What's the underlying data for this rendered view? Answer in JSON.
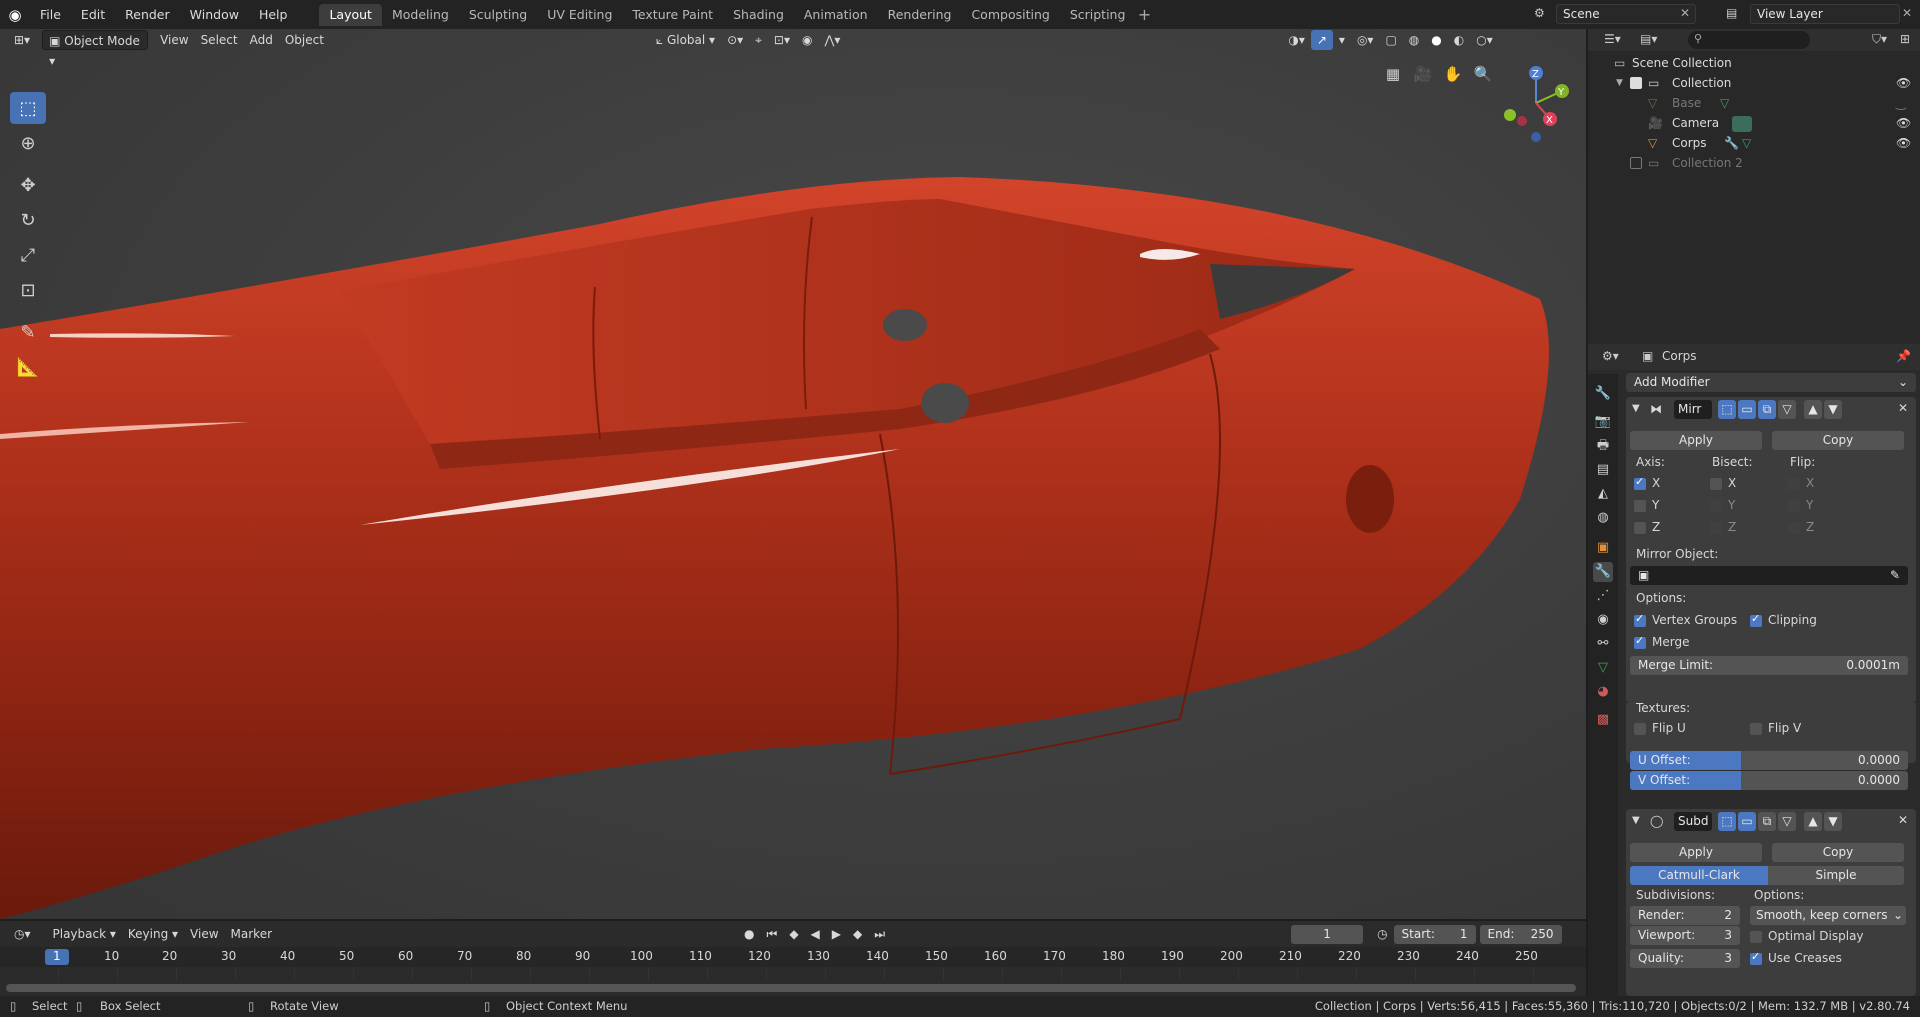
{
  "topbar": {
    "menus": [
      "File",
      "Edit",
      "Render",
      "Window",
      "Help"
    ],
    "tabs": [
      "Layout",
      "Modeling",
      "Sculpting",
      "UV Editing",
      "Texture Paint",
      "Shading",
      "Animation",
      "Rendering",
      "Compositing",
      "Scripting"
    ],
    "active_tab": "Layout",
    "scene": "Scene",
    "view_layer": "View Layer"
  },
  "viewport": {
    "mode": "Object Mode",
    "menus": [
      "View",
      "Select",
      "Add",
      "Object"
    ],
    "orientation": "Global",
    "gizmo": {
      "z": "Z",
      "y": "Y",
      "x": "X"
    },
    "object_color": "#c23a1e"
  },
  "outliner": {
    "root": "Scene Collection",
    "collection": "Collection",
    "items": [
      {
        "name": "Base",
        "dim": true
      },
      {
        "name": "Camera",
        "dim": false
      },
      {
        "name": "Corps",
        "dim": false
      }
    ],
    "collection2": "Collection 2"
  },
  "properties": {
    "object_name": "Corps",
    "add_modifier": "Add Modifier",
    "mirror": {
      "name": "Mirr",
      "apply": "Apply",
      "copy": "Copy",
      "axis_label": "Axis:",
      "bisect_label": "Bisect:",
      "flip_label": "Flip:",
      "x": "X",
      "y": "Y",
      "z": "Z",
      "mirror_object_label": "Mirror Object:",
      "options_label": "Options:",
      "vertex_groups": "Vertex Groups",
      "clipping": "Clipping",
      "merge": "Merge",
      "merge_limit_label": "Merge Limit:",
      "merge_limit_value": "0.0001m",
      "textures_label": "Textures:",
      "flip_u": "Flip U",
      "flip_v": "Flip V",
      "u_offset_label": "U Offset:",
      "u_offset_value": "0.0000",
      "v_offset_label": "V Offset:",
      "v_offset_value": "0.0000"
    },
    "subsurf": {
      "name": "Subd",
      "apply": "Apply",
      "copy": "Copy",
      "catmull": "Catmull-Clark",
      "simple": "Simple",
      "subdivisions_label": "Subdivisions:",
      "options_label": "Options:",
      "render_label": "Render:",
      "render_value": "2",
      "viewport_label": "Viewport:",
      "viewport_value": "3",
      "quality_label": "Quality:",
      "quality_value": "3",
      "uv_smooth": "Smooth, keep corners",
      "optimal_display": "Optimal Display",
      "use_creases": "Use Creases"
    }
  },
  "timeline": {
    "menus": [
      "Playback",
      "Keying",
      "View",
      "Marker"
    ],
    "current_frame": "1",
    "start_label": "Start:",
    "start": "1",
    "end_label": "End:",
    "end": "250",
    "ticks": [
      "1",
      "10",
      "20",
      "30",
      "40",
      "50",
      "60",
      "70",
      "80",
      "90",
      "100",
      "110",
      "120",
      "130",
      "140",
      "150",
      "160",
      "170",
      "180",
      "190",
      "200",
      "210",
      "220",
      "230",
      "240",
      "250"
    ]
  },
  "status": {
    "select": "Select",
    "box_select": "Box Select",
    "rotate": "Rotate View",
    "context": "Object Context Menu",
    "info": "Collection | Corps | Verts:56,415 | Faces:55,360 | Tris:110,720 | Objects:0/2 | Mem: 132.7 MB | v2.80.74"
  }
}
